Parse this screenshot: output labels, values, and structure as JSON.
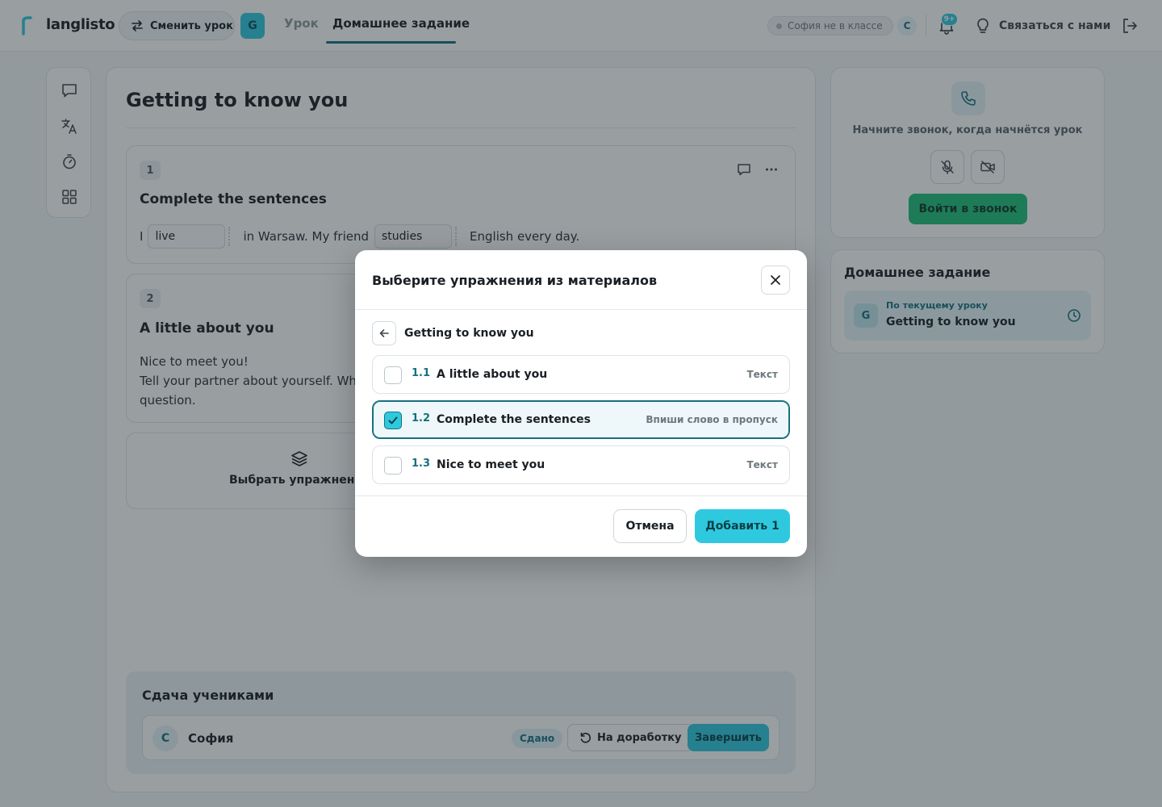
{
  "header": {
    "logo_text": "langlisto",
    "switch_lesson_label": "Сменить урок",
    "lesson_badge": "G",
    "tabs": [
      {
        "label": "Урок",
        "active": false
      },
      {
        "label": "Домашнее задание",
        "active": true
      }
    ],
    "presence_status": "София не в классе",
    "student_initial": "С",
    "notifications_badge": "9+",
    "contact_label": "Связаться с нами"
  },
  "icons": {
    "rail": [
      "chat-icon",
      "translate-icon",
      "timer-icon",
      "grid-icon"
    ],
    "topbar": [
      "swap-icon",
      "bell-icon",
      "lightbulb-icon",
      "logout-icon"
    ]
  },
  "main": {
    "title": "Getting to know you",
    "exercises": [
      {
        "number": "1",
        "title": "Complete the sentences",
        "sentence": {
          "part1": "I",
          "blank1": "live",
          "part2": "in Warsaw. My friend",
          "blank2": "studies",
          "part3": "English every day."
        }
      },
      {
        "number": "2",
        "title": "A little about you",
        "line1": "Nice to meet you!",
        "line2": "Tell your partner about yourself. Where",
        "line3": "question."
      }
    ],
    "choose_exercises_label": "Выбрать упражнения"
  },
  "submissions": {
    "title": "Сдача учениками",
    "student": {
      "initial": "С",
      "name": "София",
      "status": "Сдано",
      "rework_label": "На доработку",
      "finish_label": "Завершить"
    }
  },
  "call": {
    "hint": "Начните звонок, когда начнётся урок",
    "join_label": "Войти в звонок"
  },
  "homework": {
    "title": "Домашнее задание",
    "item": {
      "badge": "G",
      "subtitle": "По текущему уроку",
      "name": "Getting to know you"
    }
  },
  "modal": {
    "title": "Выберите упражнения из материалов",
    "breadcrumb": "Getting to know you",
    "items": [
      {
        "number": "1.1",
        "name": "A little about you",
        "type": "Текст",
        "checked": false
      },
      {
        "number": "1.2",
        "name": "Complete the sentences",
        "type": "Впиши слово в пропуск",
        "checked": true
      },
      {
        "number": "1.3",
        "name": "Nice to meet you",
        "type": "Текст",
        "checked": false
      }
    ],
    "cancel_label": "Отмена",
    "add_label": "Добавить 1"
  },
  "colors": {
    "accent": "#2ec9df",
    "accent_dark": "#17707e",
    "join_green": "#1fbf7a",
    "overlay": "rgba(28, 40, 46, 0.45)"
  }
}
